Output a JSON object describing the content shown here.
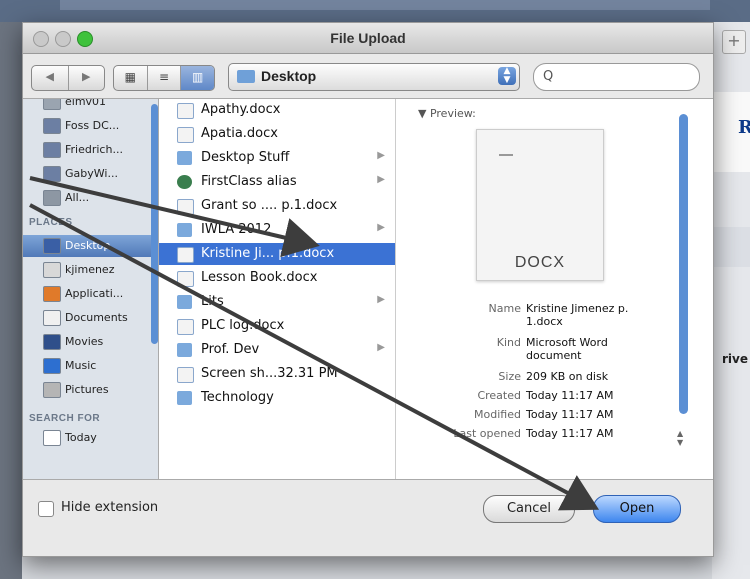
{
  "dialog": {
    "title": "File Upload",
    "location": "Desktop",
    "search_placeholder": "",
    "search_icon": "Q",
    "view_buttons": [
      "▦",
      "≡",
      "▥"
    ]
  },
  "sidebar": {
    "devices": [
      {
        "label": "elmv01",
        "icon": "drive-icon"
      },
      {
        "label": "Foss DC...",
        "icon": "computer-icon"
      },
      {
        "label": "Friedrich...",
        "icon": "computer-icon"
      },
      {
        "label": "GabyWi...",
        "icon": "computer-icon"
      },
      {
        "label": "All...",
        "icon": "network-icon"
      }
    ],
    "places_header": "PLACES",
    "places": [
      {
        "label": "Desktop",
        "icon": "desktop-icon",
        "selected": true
      },
      {
        "label": "kjimenez",
        "icon": "home-icon"
      },
      {
        "label": "Applicati...",
        "icon": "applications-icon"
      },
      {
        "label": "Documents",
        "icon": "documents-icon"
      },
      {
        "label": "Movies",
        "icon": "movies-icon"
      },
      {
        "label": "Music",
        "icon": "music-icon"
      },
      {
        "label": "Pictures",
        "icon": "pictures-icon"
      }
    ],
    "search_header": "SEARCH FOR",
    "search_items": [
      {
        "label": "Today",
        "icon": "clock-icon"
      }
    ]
  },
  "files": [
    {
      "name": "Apathy.docx",
      "type": "doc"
    },
    {
      "name": "Apatia.docx",
      "type": "doc"
    },
    {
      "name": "Desktop Stuff",
      "type": "folder",
      "has_children": true
    },
    {
      "name": "FirstClass alias",
      "type": "alias",
      "has_children": true
    },
    {
      "name": "Grant so .... p.1.docx",
      "type": "doc"
    },
    {
      "name": "IWLA 2012",
      "type": "folder",
      "has_children": true
    },
    {
      "name": "Kristine Ji... p.1.docx",
      "type": "doc",
      "selected": true
    },
    {
      "name": "Lesson Book.docx",
      "type": "doc"
    },
    {
      "name": "Lits",
      "type": "folder",
      "has_children": true
    },
    {
      "name": "PLC log.docx",
      "type": "doc"
    },
    {
      "name": "Prof. Dev",
      "type": "folder",
      "has_children": true
    },
    {
      "name": "Screen sh...32.31 PM",
      "type": "doc"
    },
    {
      "name": "Technology",
      "type": "folder"
    }
  ],
  "preview": {
    "heading": "▼ Preview:",
    "ext": "DOCX",
    "meta": [
      {
        "key": "Name",
        "value": "Kristine Jimenez p. 1.docx"
      },
      {
        "key": "Kind",
        "value": "Microsoft Word document"
      },
      {
        "key": "Size",
        "value": "209 KB on disk"
      },
      {
        "key": "Created",
        "value": "Today 11:17 AM"
      },
      {
        "key": "Modified",
        "value": "Today 11:17 AM"
      },
      {
        "key": "Last opened",
        "value": "Today 11:17 AM"
      }
    ]
  },
  "footer": {
    "hide_extension": "Hide extension",
    "cancel": "Cancel",
    "open": "Open"
  },
  "background": {
    "new_tab": "+",
    "logo_letter": "R",
    "partial_text": "rive"
  },
  "colors": {
    "selection": "#3b72d4",
    "sidebar_selection": "#5179b8",
    "annotation_arrow": "#3d3d3d"
  }
}
